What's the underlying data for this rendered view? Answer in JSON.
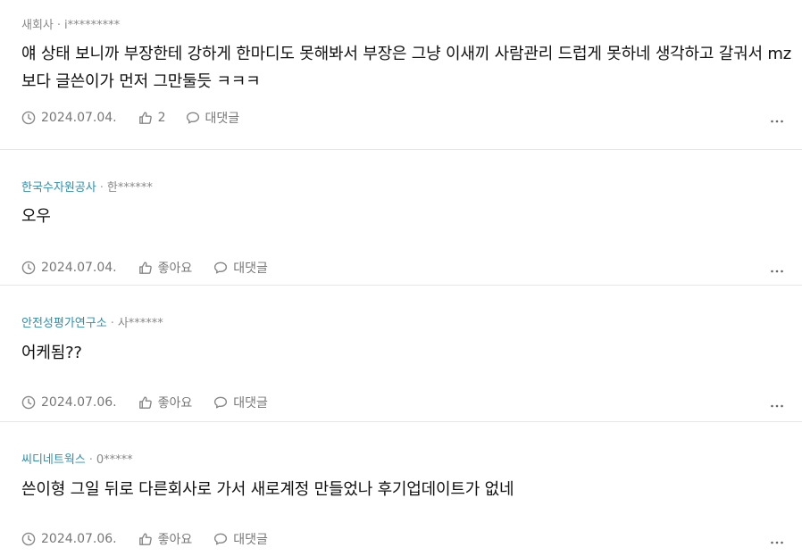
{
  "comments": [
    {
      "company": "새회사",
      "company_is_link": false,
      "separator": "·",
      "nickname": "i*********",
      "text": "얘 상태 보니까 부장한테 강하게 한마디도 못해봐서 부장은 그냥 이새끼 사람관리 드럽게 못하네 생각하고 갈궈서 mz보다 글쓴이가 먼저 그만둘듯 ㅋㅋㅋ",
      "date": "2024.07.04.",
      "like_label": "2",
      "reply_label": "대댓글"
    },
    {
      "company": "한국수자원공사",
      "company_is_link": true,
      "separator": "·",
      "nickname": "한******",
      "text": "오우",
      "date": "2024.07.04.",
      "like_label": "좋아요",
      "reply_label": "대댓글"
    },
    {
      "company": "안전성평가연구소",
      "company_is_link": true,
      "separator": "·",
      "nickname": "사******",
      "text": "어케됨??",
      "date": "2024.07.06.",
      "like_label": "좋아요",
      "reply_label": "대댓글"
    },
    {
      "company": "씨디네트웍스",
      "company_is_link": true,
      "separator": "·",
      "nickname": "0*****",
      "text": "쓴이형 그일 뒤로 다른회사로 가서 새로계정 만들었나 후기업데이트가 없네",
      "date": "2024.07.06.",
      "like_label": "좋아요",
      "reply_label": "대댓글"
    }
  ],
  "icons": {
    "date": "clock-icon",
    "like": "thumbs-up-icon",
    "reply": "speech-bubble-icon",
    "more": "more-horizontal-icon"
  },
  "colors": {
    "company_link": "#2b8fb0",
    "meta_gray": "#888888",
    "text": "#111111",
    "divider": "#e6e6e6"
  }
}
